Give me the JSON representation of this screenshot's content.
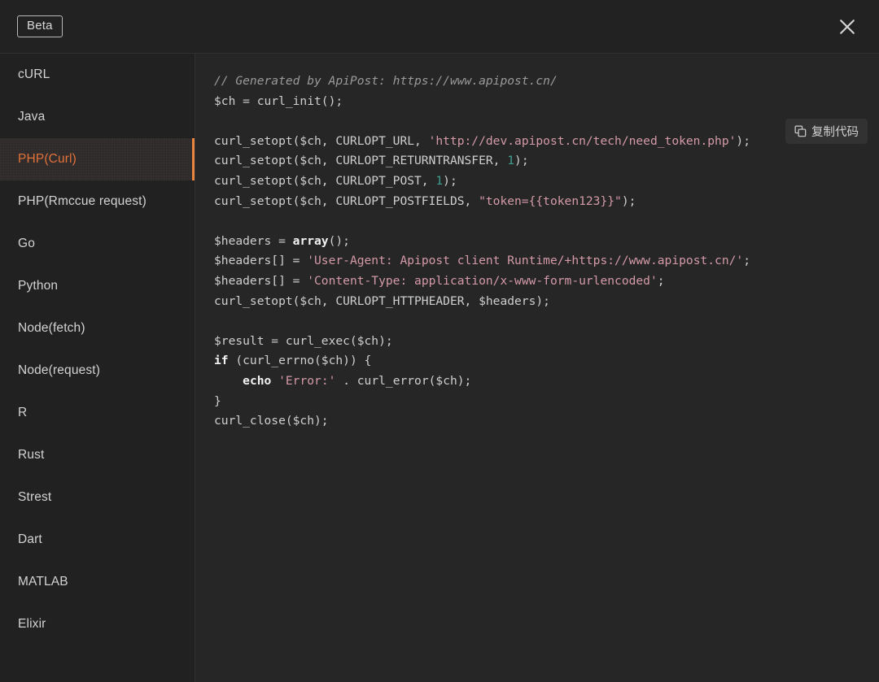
{
  "header": {
    "beta_label": "Beta",
    "close_icon": "close-icon"
  },
  "sidebar": {
    "items": [
      {
        "label": "cURL",
        "active": false
      },
      {
        "label": "Java",
        "active": false
      },
      {
        "label": "PHP(Curl)",
        "active": true
      },
      {
        "label": "PHP(Rmccue request)",
        "active": false
      },
      {
        "label": "Go",
        "active": false
      },
      {
        "label": "Python",
        "active": false
      },
      {
        "label": "Node(fetch)",
        "active": false
      },
      {
        "label": "Node(request)",
        "active": false
      },
      {
        "label": "R",
        "active": false
      },
      {
        "label": "Rust",
        "active": false
      },
      {
        "label": "Strest",
        "active": false
      },
      {
        "label": "Dart",
        "active": false
      },
      {
        "label": "MATLAB",
        "active": false
      },
      {
        "label": "Elixir",
        "active": false
      }
    ],
    "active_index": 2,
    "accent_color": "#e8843c",
    "active_text_color": "#e2713a"
  },
  "code_panel": {
    "copy_button_label": "复制代码",
    "copy_button_icon": "copy-icon",
    "language": "PHP(Curl)",
    "code_text": "// Generated by ApiPost: https://www.apipost.cn/\n$ch = curl_init();\n\ncurl_setopt($ch, CURLOPT_URL, 'http://dev.apipost.cn/tech/need_token.php');\ncurl_setopt($ch, CURLOPT_RETURNTRANSFER, 1);\ncurl_setopt($ch, CURLOPT_POST, 1);\ncurl_setopt($ch, CURLOPT_POSTFIELDS, \"token={{token123}}\");\n\n$headers = array();\n$headers[] = 'User-Agent: Apipost client Runtime/+https://www.apipost.cn/';\n$headers[] = 'Content-Type: application/x-www-form-urlencoded';\ncurl_setopt($ch, CURLOPT_HTTPHEADER, $headers);\n\n$result = curl_exec($ch);\nif (curl_errno($ch)) {\n    echo 'Error:' . curl_error($ch);\n}\ncurl_close($ch);",
    "tokens": [
      [
        {
          "t": "comment",
          "v": "// Generated by ApiPost: https://www.apipost.cn/"
        }
      ],
      [
        {
          "t": "plain",
          "v": "$ch = curl_init();"
        }
      ],
      [
        {
          "t": "plain",
          "v": ""
        }
      ],
      [
        {
          "t": "plain",
          "v": "curl_setopt($ch, CURLOPT_URL, "
        },
        {
          "t": "string",
          "v": "'http://dev.apipost.cn/tech/need_token.php'"
        },
        {
          "t": "plain",
          "v": ");"
        }
      ],
      [
        {
          "t": "plain",
          "v": "curl_setopt($ch, CURLOPT_RETURNTRANSFER, "
        },
        {
          "t": "number",
          "v": "1"
        },
        {
          "t": "plain",
          "v": ");"
        }
      ],
      [
        {
          "t": "plain",
          "v": "curl_setopt($ch, CURLOPT_POST, "
        },
        {
          "t": "number",
          "v": "1"
        },
        {
          "t": "plain",
          "v": ");"
        }
      ],
      [
        {
          "t": "plain",
          "v": "curl_setopt($ch, CURLOPT_POSTFIELDS, "
        },
        {
          "t": "string",
          "v": "\"token={{token123}}\""
        },
        {
          "t": "plain",
          "v": ");"
        }
      ],
      [
        {
          "t": "plain",
          "v": ""
        }
      ],
      [
        {
          "t": "plain",
          "v": "$headers = "
        },
        {
          "t": "keyword",
          "v": "array"
        },
        {
          "t": "plain",
          "v": "();"
        }
      ],
      [
        {
          "t": "plain",
          "v": "$headers[] = "
        },
        {
          "t": "string",
          "v": "'User-Agent: Apipost client Runtime/+https://www.apipost.cn/'"
        },
        {
          "t": "plain",
          "v": ";"
        }
      ],
      [
        {
          "t": "plain",
          "v": "$headers[] = "
        },
        {
          "t": "string",
          "v": "'Content-Type: application/x-www-form-urlencoded'"
        },
        {
          "t": "plain",
          "v": ";"
        }
      ],
      [
        {
          "t": "plain",
          "v": "curl_setopt($ch, CURLOPT_HTTPHEADER, $headers);"
        }
      ],
      [
        {
          "t": "plain",
          "v": ""
        }
      ],
      [
        {
          "t": "plain",
          "v": "$result = curl_exec($ch);"
        }
      ],
      [
        {
          "t": "keyword",
          "v": "if"
        },
        {
          "t": "plain",
          "v": " (curl_errno($ch)) {"
        }
      ],
      [
        {
          "t": "plain",
          "v": "    "
        },
        {
          "t": "keyword",
          "v": "echo"
        },
        {
          "t": "plain",
          "v": " "
        },
        {
          "t": "string",
          "v": "'Error:'"
        },
        {
          "t": "plain",
          "v": " . curl_error($ch);"
        }
      ],
      [
        {
          "t": "plain",
          "v": "}"
        }
      ],
      [
        {
          "t": "plain",
          "v": "curl_close($ch);"
        }
      ]
    ]
  },
  "colors": {
    "window_bg": "#222222",
    "sidebar_bg": "#212121",
    "code_bg": "#262626",
    "accent": "#e8843c",
    "comment": "#9a9a9a",
    "string": "#d49aa8",
    "number": "#3d9e90",
    "keyword": "#f2f2f2",
    "text": "#cfcfcf"
  }
}
